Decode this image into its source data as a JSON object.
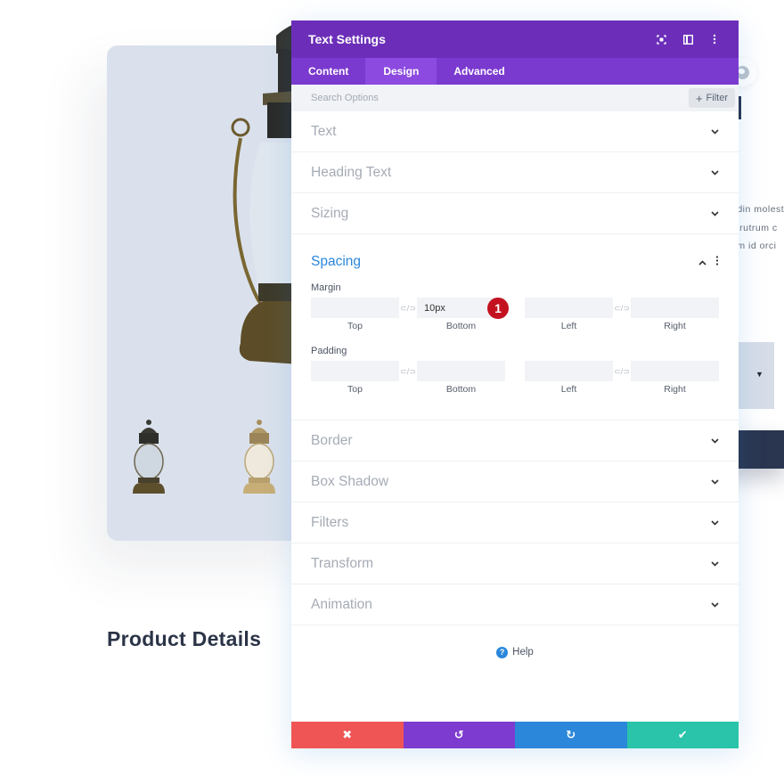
{
  "background": {
    "product_title": "Product Details",
    "side_text": [
      "udin molest",
      "c rutrum c",
      "um id orci"
    ]
  },
  "modal": {
    "title": "Text Settings",
    "header_icons": [
      "focus-icon",
      "split-view-icon",
      "more-options-icon"
    ],
    "tabs": [
      {
        "label": "Content",
        "active": false
      },
      {
        "label": "Design",
        "active": true
      },
      {
        "label": "Advanced",
        "active": false
      }
    ],
    "search": {
      "placeholder": "Search Options",
      "value": ""
    },
    "filter_label": "Filter",
    "sections_before": [
      {
        "label": "Text"
      },
      {
        "label": "Heading Text"
      },
      {
        "label": "Sizing"
      }
    ],
    "spacing": {
      "label": "Spacing",
      "expanded": true,
      "margin": {
        "label": "Margin",
        "top": {
          "caption": "Top",
          "value": ""
        },
        "bottom": {
          "caption": "Bottom",
          "value": "10px"
        },
        "left": {
          "caption": "Left",
          "value": ""
        },
        "right": {
          "caption": "Right",
          "value": ""
        }
      },
      "padding": {
        "label": "Padding",
        "top": {
          "caption": "Top",
          "value": ""
        },
        "bottom": {
          "caption": "Bottom",
          "value": ""
        },
        "left": {
          "caption": "Left",
          "value": ""
        },
        "right": {
          "caption": "Right",
          "value": ""
        }
      },
      "annotation_badge": "1"
    },
    "sections_after": [
      {
        "label": "Border"
      },
      {
        "label": "Box Shadow"
      },
      {
        "label": "Filters"
      },
      {
        "label": "Transform"
      },
      {
        "label": "Animation"
      }
    ],
    "help_label": "Help",
    "footer": {
      "cancel_icon": "✖",
      "undo_icon": "↺",
      "redo_icon": "↻",
      "save_icon": "✔"
    }
  },
  "colors": {
    "header": "#6c2eb9",
    "tabs": "#7b3acf",
    "accent_blue": "#2b87da",
    "cancel": "#ef5555",
    "undo": "#7d3bcf",
    "redo": "#2b87da",
    "save": "#29c4a9",
    "badge": "#c4111f"
  }
}
